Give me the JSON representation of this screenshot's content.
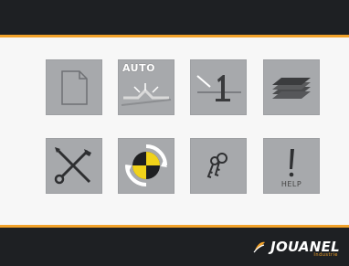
{
  "header": {},
  "tiles": {
    "row1": [
      {
        "name": "new-file",
        "icon": "document-icon"
      },
      {
        "name": "auto",
        "icon": "auto-bend-icon",
        "label": "AUTO"
      },
      {
        "name": "single-step",
        "icon": "number-one-icon"
      },
      {
        "name": "layers",
        "icon": "layers-icon"
      }
    ],
    "row2": [
      {
        "name": "tools",
        "icon": "wrench-screwdriver-icon"
      },
      {
        "name": "calibration",
        "icon": "target-rotate-icon"
      },
      {
        "name": "keys",
        "icon": "keys-icon"
      },
      {
        "name": "help",
        "icon": "exclamation-icon",
        "label": "HELP"
      }
    ]
  },
  "footer": {
    "brand": "JOUANEL",
    "tagline": "Industrie"
  },
  "colors": {
    "bar": "#1e2023",
    "accent": "#f2a22a",
    "tile": "#a7a9ac",
    "target_yellow": "#f1d21a"
  }
}
